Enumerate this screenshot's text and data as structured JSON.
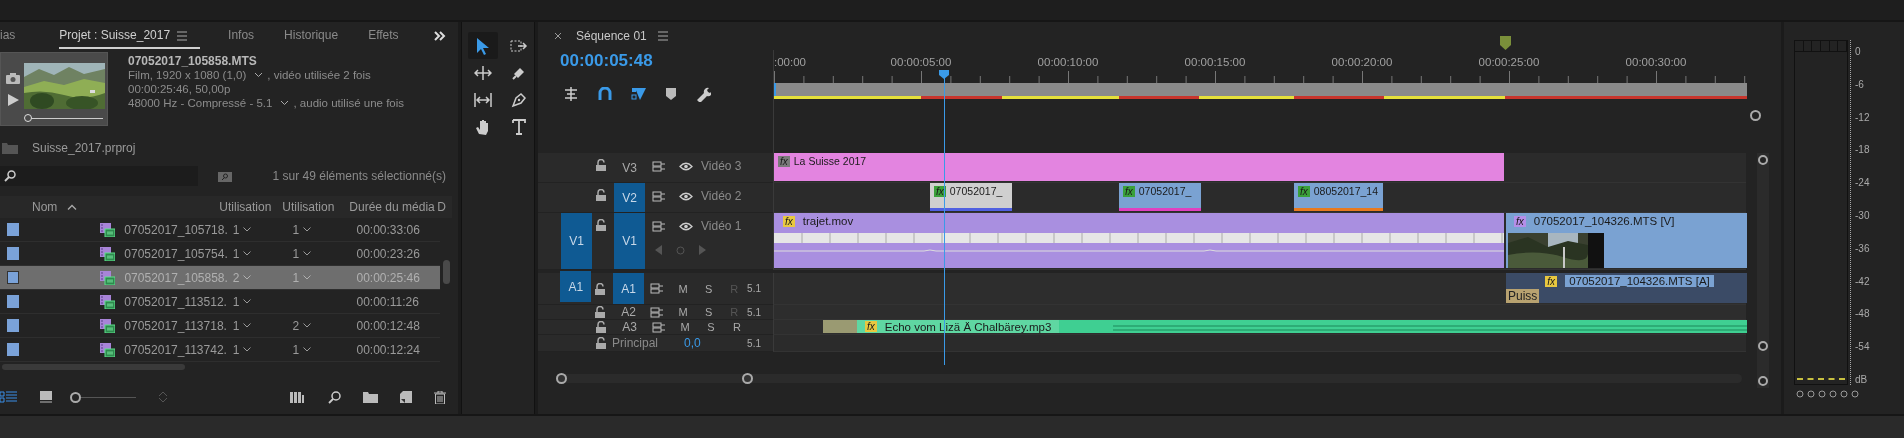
{
  "project_panel": {
    "tabs": [
      {
        "label": "ias",
        "selected": false
      },
      {
        "label": "Projet : Suisse_2017",
        "selected": true
      },
      {
        "label": "Infos",
        "selected": false
      },
      {
        "label": "Historique",
        "selected": false
      },
      {
        "label": "Effets",
        "selected": false
      }
    ],
    "clip_info": {
      "name": "07052017_105858.MTS",
      "lines": [
        {
          "text": "Film, 1920 x 1080 (1,0)",
          "suffix": ", vidéo utilisée 2 fois"
        },
        {
          "text": "00:00:25:46, 50,00p"
        },
        {
          "text": "48000 Hz - Compressé - 5.1",
          "suffix": ", audio utilisé une fois"
        }
      ]
    },
    "project_file": "Suisse_2017.prproj",
    "icon_size": {
      "level": 0
    },
    "selection_count": "1 sur 49 éléments sélectionné(s)",
    "table": {
      "columns": [
        "Nom",
        "Utilisation",
        "Utilisation",
        "Durée du média",
        "D"
      ],
      "rows": [
        {
          "name": "07052017_105718.",
          "video_uses": "1",
          "audio_uses": "1",
          "duration": "00:00:33:06",
          "selected": false
        },
        {
          "name": "07052017_105754.",
          "video_uses": "1",
          "audio_uses": "1",
          "duration": "00:00:23:26",
          "selected": false
        },
        {
          "name": "07052017_105858.",
          "video_uses": "2",
          "audio_uses": "1",
          "duration": "00:00:25:46",
          "selected": true
        },
        {
          "name": "07052017_113512.",
          "video_uses": "1",
          "duration": "00:00:11:26",
          "selected": false
        },
        {
          "name": "07052017_113718.",
          "video_uses": "1",
          "audio_uses": "2",
          "duration": "00:00:12:48",
          "selected": false
        },
        {
          "name": "07052017_113742.",
          "video_uses": "1",
          "audio_uses": "1",
          "duration": "00:00:12:24",
          "selected": false
        }
      ]
    }
  },
  "timeline": {
    "tab": "Séquence 01",
    "timecode": "00:00:05:48",
    "ruler_labels": [
      ":00:00",
      "00:00:05:00",
      "00:00:10:00",
      "00:00:15:00",
      "00:00:20:00",
      "00:00:25:00",
      "00:00:30:00"
    ],
    "tracks": [
      {
        "kind": "video",
        "name": "V3",
        "label": "Vidéo 3",
        "targeted": false,
        "expanded": false,
        "clips": [
          {
            "kind": "plain",
            "label": "La Suisse 2017",
            "color": "#e384e0",
            "badge": "fx"
          }
        ]
      },
      {
        "kind": "video",
        "name": "V2",
        "label": "Vidéo 2",
        "targeted": true,
        "expanded": false,
        "clips": [
          {
            "kind": "plain",
            "label": "07052017_",
            "color": "#cfcfcf",
            "badge": "fx",
            "markers": [
              {
                "color": "#5060e0"
              }
            ]
          },
          {
            "kind": "plain",
            "label": "07052017_",
            "color": "#7aa2d2",
            "badge": "fx",
            "markers": [
              {
                "color": "#e040c0"
              }
            ]
          },
          {
            "kind": "plain",
            "label": "08052017_14",
            "color": "#7aa2d2",
            "badge": "fx",
            "markers": [
              {
                "color": "#e87a20"
              }
            ]
          }
        ]
      },
      {
        "kind": "video",
        "name": "V1",
        "label": "Vidéo 1",
        "targeted": true,
        "expanded": true,
        "source": "V1",
        "clips": [
          {
            "kind": "keyframes",
            "label": "trajet.mov",
            "color": "#a98fe0",
            "badge": "fx"
          },
          {
            "kind": "thumbnail",
            "label": "07052017_104326.MTS [V]",
            "color": "#7aa2d2",
            "badge": "fx"
          }
        ]
      },
      {
        "kind": "audio",
        "name": "A1",
        "targeted": true,
        "source": "A1",
        "buttons": [
          {
            "label": "M",
            "disabled": false
          },
          {
            "label": "S",
            "disabled": false
          },
          {
            "label": "R",
            "disabled": true
          }
        ],
        "channels": "5.1",
        "clips": [
          {
            "kind": "audio",
            "label": "07052017_104326.MTS [A]",
            "color": "#3b4b66",
            "badge": "fx",
            "tag": "Puiss"
          }
        ]
      },
      {
        "kind": "audio",
        "name": "A2",
        "targeted": false,
        "buttons": [
          {
            "label": "M",
            "disabled": false
          },
          {
            "label": "S",
            "disabled": false
          },
          {
            "label": "R",
            "disabled": true
          }
        ],
        "channels": "5.1"
      },
      {
        "kind": "audio",
        "name": "A3",
        "targeted": false,
        "buttons": [
          {
            "label": "M",
            "disabled": false
          },
          {
            "label": "S",
            "disabled": false
          },
          {
            "label": "R",
            "disabled": false
          }
        ],
        "clips": [
          {
            "kind": "waveform",
            "label": "Echo vom Lizä Ä Chalbärey.mp3",
            "color": "#3fcf92",
            "badge": "fx"
          }
        ]
      },
      {
        "kind": "master",
        "name": "Principal",
        "value": "0,0",
        "channels": "5.1"
      }
    ]
  },
  "audio_meter": {
    "scale": [
      "0",
      "-6",
      "-12",
      "-18",
      "-24",
      "-30",
      "-36",
      "-42",
      "-48",
      "-54",
      "dB"
    ]
  }
}
